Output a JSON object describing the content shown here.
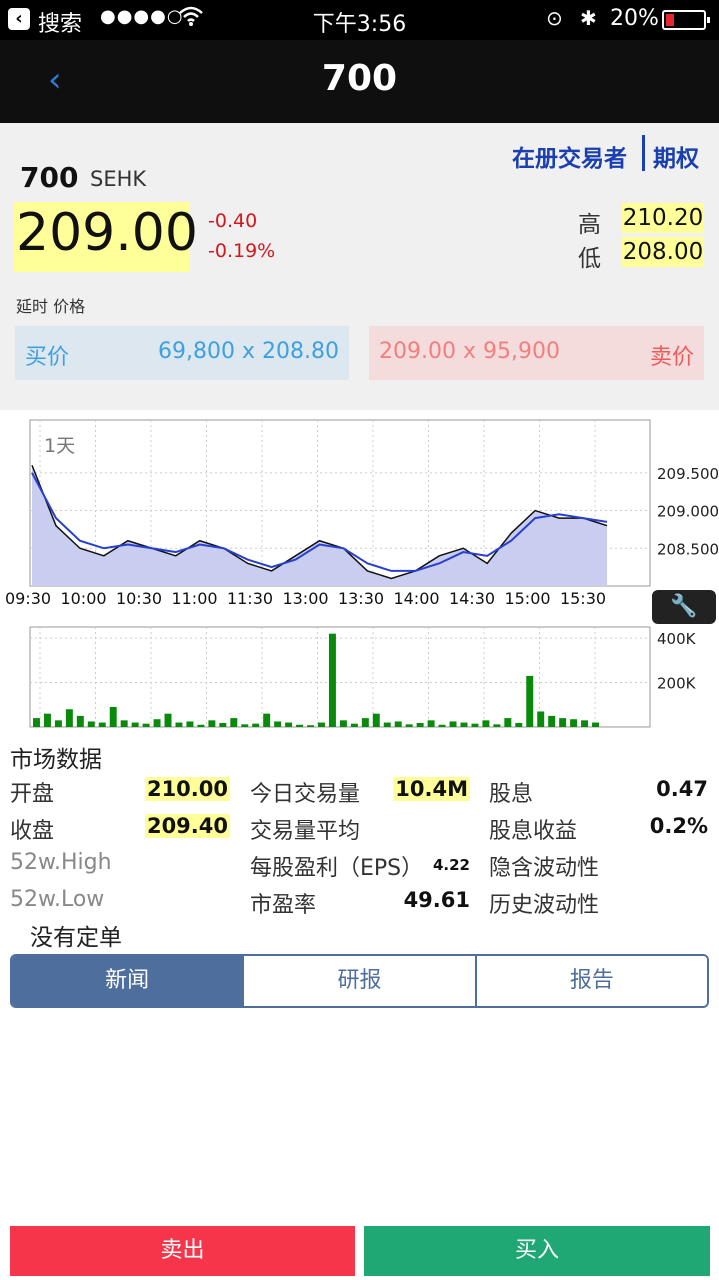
{
  "status_bar": {
    "back_app": "搜索",
    "signal": "●●●●○",
    "time": "下午3:56",
    "battery": "20%"
  },
  "nav": {
    "back_icon": "‹",
    "title": "700"
  },
  "quote": {
    "registered_traders": "在册交易者",
    "options": "期权",
    "symbol": "700",
    "exchange": "SEHK",
    "last": "209.00",
    "change": "-0.40",
    "change_pct": "-0.19%",
    "high_label": "高",
    "high": "210.20",
    "low_label": "低",
    "low": "208.00",
    "delayed": "延时 价格",
    "bid_label": "买价",
    "bid": "69,800 x 208.80",
    "ask": "209.00 x 95,900",
    "ask_label": "卖价"
  },
  "chart_data": [
    {
      "type": "line",
      "title": "",
      "period_label": "1天",
      "x": [
        "09:30",
        "10:00",
        "10:30",
        "11:00",
        "11:30",
        "13:00",
        "13:30",
        "14:00",
        "14:30",
        "15:00",
        "15:30"
      ],
      "ylim": [
        208.0,
        210.2
      ],
      "y_ticks": [
        "209.500",
        "209.000",
        "208.500"
      ],
      "series": [
        {
          "values": [
            209.6,
            208.8,
            208.5,
            208.4,
            208.6,
            208.5,
            208.4,
            208.6,
            208.5,
            208.3,
            208.2,
            208.4,
            208.6,
            208.5,
            208.2,
            208.1,
            208.2,
            208.4,
            208.5,
            208.3,
            208.7,
            209.0,
            208.9,
            208.9,
            208.8
          ]
        },
        {
          "values": [
            209.5,
            208.9,
            208.6,
            208.5,
            208.55,
            208.5,
            208.45,
            208.55,
            208.5,
            208.35,
            208.25,
            208.35,
            208.55,
            208.5,
            208.3,
            208.2,
            208.2,
            208.3,
            208.45,
            208.4,
            208.6,
            208.9,
            208.95,
            208.9,
            208.85
          ]
        }
      ],
      "grid": true,
      "legend": "none"
    },
    {
      "type": "bar",
      "title": "",
      "y_ticks": [
        "400K",
        "200K"
      ],
      "ylim": [
        0,
        450000
      ],
      "values": [
        40000,
        60000,
        30000,
        80000,
        50000,
        25000,
        20000,
        90000,
        30000,
        20000,
        15000,
        35000,
        60000,
        20000,
        25000,
        10000,
        30000,
        18000,
        40000,
        12000,
        15000,
        60000,
        25000,
        20000,
        10000,
        8000,
        20000,
        420000,
        30000,
        15000,
        40000,
        60000,
        20000,
        25000,
        12000,
        18000,
        30000,
        10000,
        25000,
        20000,
        15000,
        30000,
        12000,
        40000,
        18000,
        230000,
        70000,
        50000,
        40000,
        35000,
        30000,
        20000
      ],
      "color": "#0a8a0a",
      "grid": true,
      "legend": "none"
    }
  ],
  "chart_tool_icon": "wrench-icon",
  "market_data": {
    "title": "市场数据",
    "rows": [
      {
        "l1": "开盘",
        "v1": "210.00",
        "l2": "今日交易量",
        "v2": "10.4M",
        "l3": "股息",
        "v3": "0.47"
      },
      {
        "l1": "收盘",
        "v1": "209.40",
        "l2": "交易量平均",
        "v2": "",
        "l3": "股息收益",
        "v3": "0.2%"
      },
      {
        "l1": "52w.High",
        "v1": "",
        "l2": "每股盈利（EPS）",
        "v2": "4.22",
        "l3": "隐含波动性",
        "v3": ""
      },
      {
        "l1": "52w.Low",
        "v1": "",
        "l2": "市盈率",
        "v2": "49.61",
        "l3": "历史波动性",
        "v3": ""
      }
    ]
  },
  "orders": {
    "empty": "没有定单"
  },
  "tabs": [
    "新闻",
    "研报",
    "报告"
  ],
  "actions": {
    "sell": "卖出",
    "buy": "买入"
  }
}
